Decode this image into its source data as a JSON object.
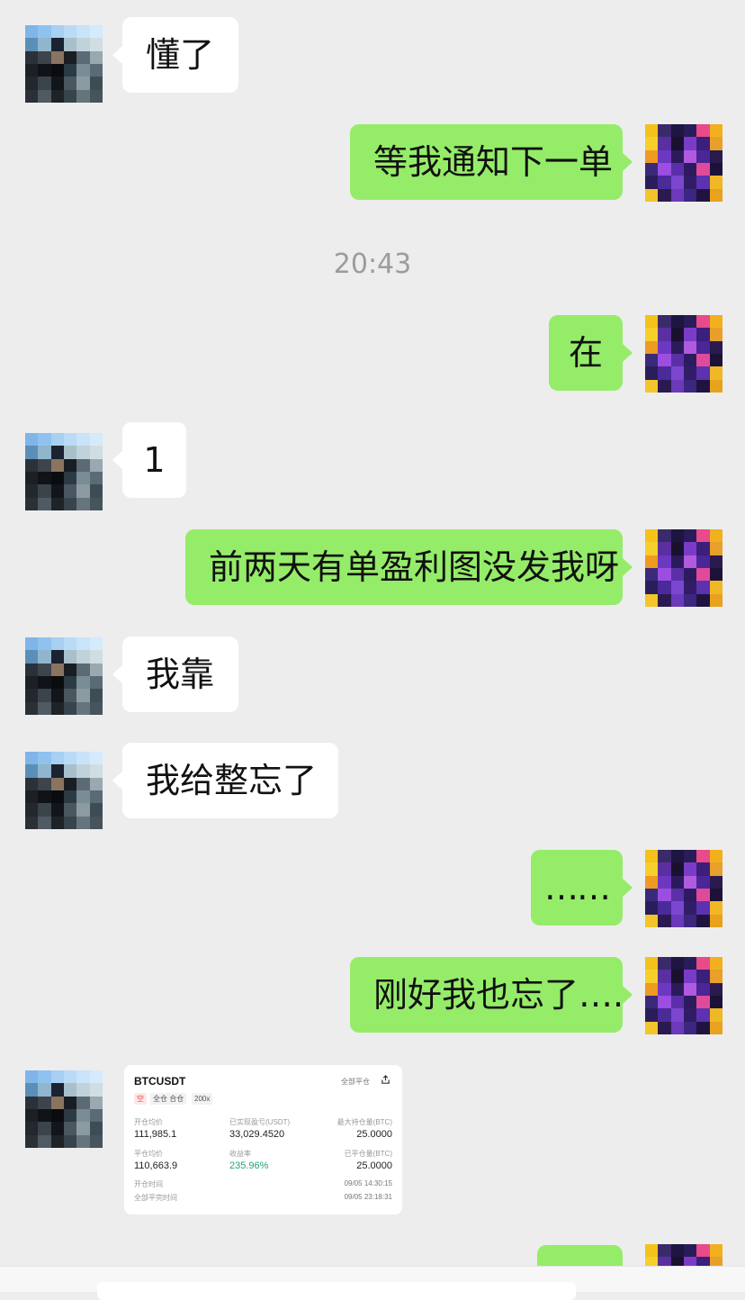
{
  "colors": {
    "background": "#ededed",
    "bubble_self": "#95ec69",
    "bubble_other": "#ffffff",
    "profit_green": "#26a17b"
  },
  "messages": [
    {
      "from": "other",
      "text": "懂了"
    },
    {
      "from": "self",
      "text": "等我通知下一单"
    },
    {
      "from": "time",
      "text": "20:43"
    },
    {
      "from": "self",
      "text": "在"
    },
    {
      "from": "other",
      "text": "1"
    },
    {
      "from": "self",
      "text": "前两天有单盈利图没发我呀"
    },
    {
      "from": "other",
      "text": "我靠"
    },
    {
      "from": "other",
      "text": "我给整忘了"
    },
    {
      "from": "self",
      "text": "……"
    },
    {
      "from": "self",
      "text": "刚好我也忘了…."
    }
  ],
  "card": {
    "symbol": "BTCUSDT",
    "close_all": "全部平仓",
    "share_icon": "share-icon",
    "tags": {
      "side": "空",
      "margin_mode": "全仓 合仓",
      "leverage": "200x"
    },
    "open_price_label": "开仓均价",
    "open_price": "111,985.1",
    "realized_pnl_label": "已实现盈亏(USDT)",
    "realized_pnl": "33,029.4520",
    "max_position_label": "最大持仓量(BTC)",
    "max_position": "25.0000",
    "close_price_label": "平仓均价",
    "close_price": "110,663.9",
    "roi_label": "收益率",
    "roi": "235.96%",
    "closed_qty_label": "已平仓量(BTC)",
    "closed_qty": "25.0000",
    "open_time_label": "开仓时间",
    "open_time": "09/05 14:30:15",
    "close_time_label": "全部平完时间",
    "close_time": "09/05 23:18:31"
  }
}
